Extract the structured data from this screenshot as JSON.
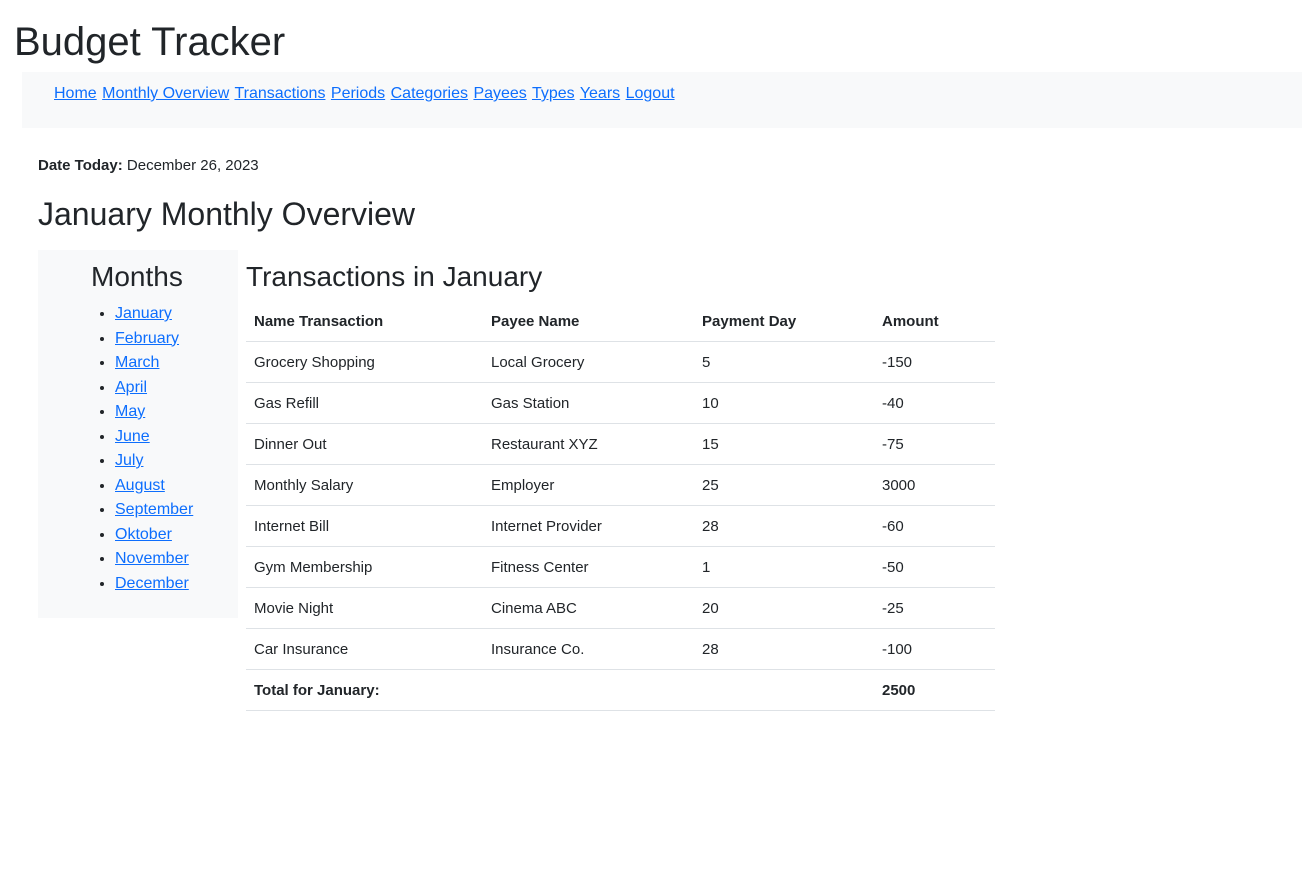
{
  "app": {
    "title": "Budget Tracker"
  },
  "nav": {
    "items": [
      {
        "label": "Home"
      },
      {
        "label": "Monthly Overview"
      },
      {
        "label": "Transactions"
      },
      {
        "label": "Periods"
      },
      {
        "label": "Categories"
      },
      {
        "label": "Payees"
      },
      {
        "label": "Types"
      },
      {
        "label": "Years"
      },
      {
        "label": "Logout"
      }
    ]
  },
  "date": {
    "label": "Date Today:",
    "value": "December 26, 2023"
  },
  "page": {
    "heading": "January Monthly Overview"
  },
  "months": {
    "heading": "Months",
    "items": [
      "January",
      "February",
      "March",
      "April",
      "May",
      "June",
      "July",
      "August",
      "September",
      "Oktober",
      "November",
      "December"
    ]
  },
  "transactions": {
    "heading": "Transactions in January",
    "columns": [
      "Name Transaction",
      "Payee Name",
      "Payment Day",
      "Amount"
    ],
    "rows": [
      [
        "Grocery Shopping",
        "Local Grocery",
        "5",
        "-150"
      ],
      [
        "Gas Refill",
        "Gas Station",
        "10",
        "-40"
      ],
      [
        "Dinner Out",
        "Restaurant XYZ",
        "15",
        "-75"
      ],
      [
        "Monthly Salary",
        "Employer",
        "25",
        "3000"
      ],
      [
        "Internet Bill",
        "Internet Provider",
        "28",
        "-60"
      ],
      [
        "Gym Membership",
        "Fitness Center",
        "1",
        "-50"
      ],
      [
        "Movie Night",
        "Cinema ABC",
        "20",
        "-25"
      ],
      [
        "Car Insurance",
        "Insurance Co.",
        "28",
        "-100"
      ]
    ],
    "total_label": "Total for January:",
    "total_value": "2500"
  },
  "colors": {
    "link": "#0d6efd",
    "panel_bg": "#f8f9fa",
    "border": "#dee2e6",
    "text": "#212529"
  }
}
